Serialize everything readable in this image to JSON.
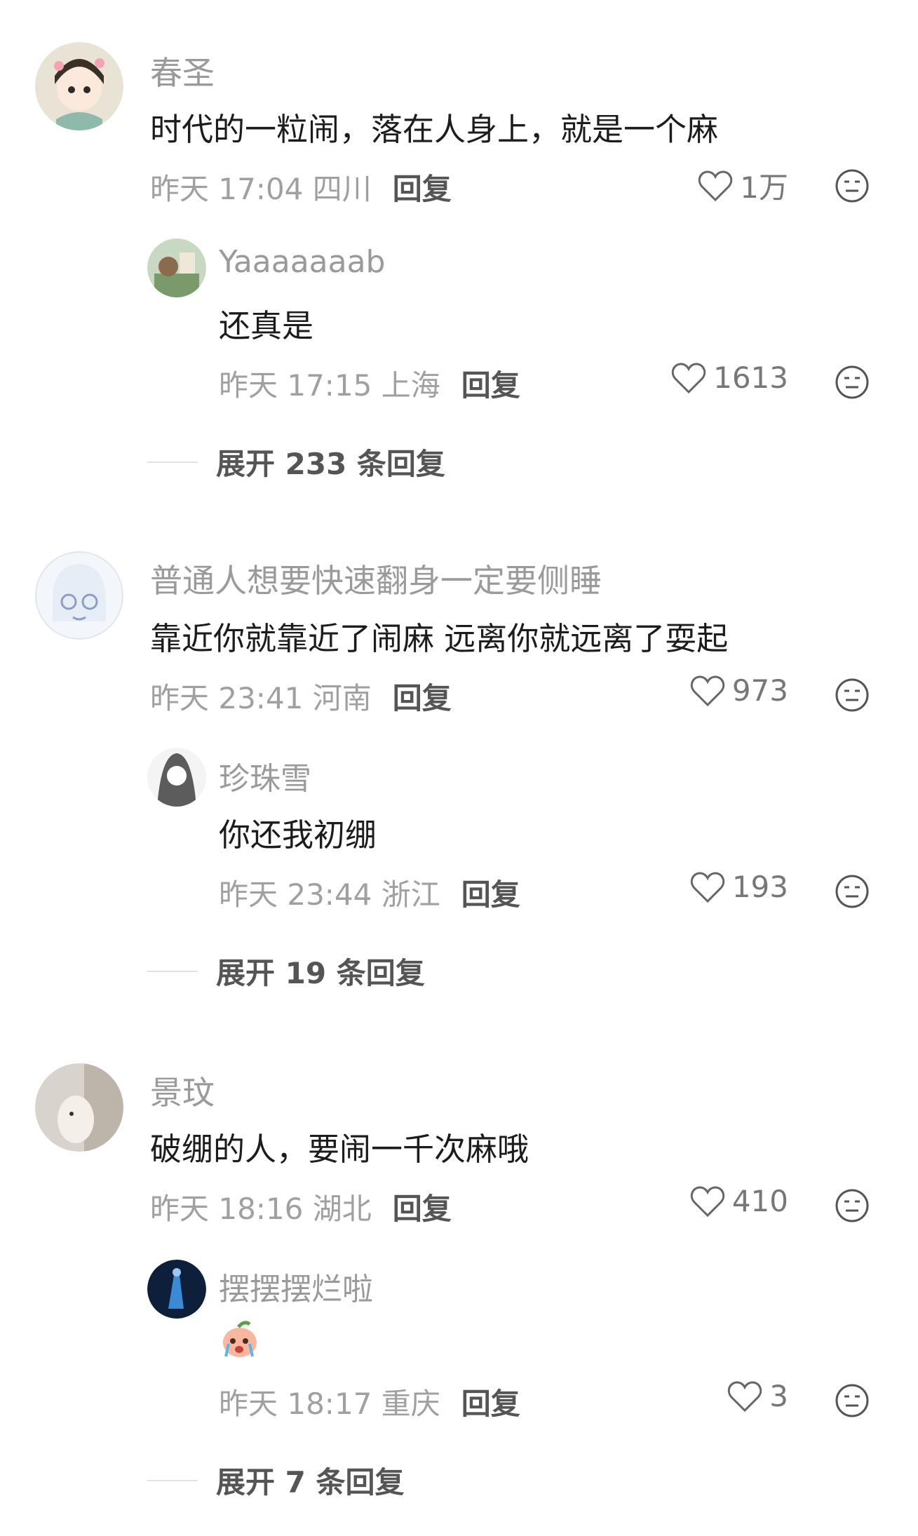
{
  "comments": [
    {
      "username": "春圣",
      "text": "时代的一粒闹，落在人身上，就是一个麻",
      "time": "昨天 17:04 四川",
      "reply_label": "回复",
      "likes": "1万",
      "reply": {
        "username": "Yaaaaaaab",
        "text": "还真是",
        "time": "昨天 17:15 上海",
        "reply_label": "回复",
        "likes": "1613"
      },
      "expand_label": "展开 233 条回复"
    },
    {
      "username": "普通人想要快速翻身一定要侧睡",
      "text": "靠近你就靠近了闹麻 远离你就远离了耍起",
      "time": "昨天 23:41 河南",
      "reply_label": "回复",
      "likes": "973",
      "reply": {
        "username": "珍珠雪",
        "text": "你还我初绷",
        "time": "昨天 23:44 浙江",
        "reply_label": "回复",
        "likes": "193"
      },
      "expand_label": "展开 19 条回复"
    },
    {
      "username": "景玟",
      "text": "破绷的人，要闹一千次麻哦",
      "time": "昨天 18:16 湖北",
      "reply_label": "回复",
      "likes": "410",
      "reply": {
        "username": "摆摆摆烂啦",
        "sticker": "crying-peach-sticker",
        "time": "昨天 18:17 重庆",
        "reply_label": "回复",
        "likes": "3"
      },
      "expand_label": "展开 7 条回复"
    }
  ],
  "icons": {
    "like": "heart-outline-icon",
    "dislike": "neutral-face-icon"
  },
  "colors": {
    "username": "#9a9a9a",
    "meta": "#a0a0a0",
    "reply_action": "#555555"
  }
}
